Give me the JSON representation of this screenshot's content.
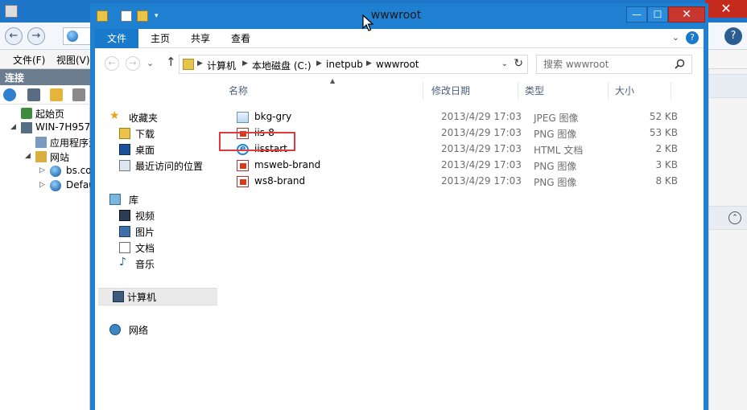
{
  "background_app": {
    "close_glyph": "✕",
    "help_glyph": "?",
    "menu": [
      {
        "label": "文件(F)"
      },
      {
        "label": "视图(V)"
      }
    ],
    "connections_label": "连接",
    "tree": [
      {
        "label": "起始页"
      },
      {
        "label": "WIN-7H957"
      },
      {
        "label": "应用程序池"
      },
      {
        "label": "网站"
      },
      {
        "label": "bs.co"
      },
      {
        "label": "Defau"
      }
    ]
  },
  "explorer": {
    "title": "wwwroot",
    "window_buttons": {
      "minimize": "—",
      "maximize": "☐",
      "close": "✕"
    },
    "ribbon": {
      "file_tab": "文件",
      "tabs": [
        "主页",
        "共享",
        "查看"
      ],
      "expand_glyph": "⌄",
      "help_glyph": "?"
    },
    "nav": {
      "back_glyph": "←",
      "forward_glyph": "→",
      "up_glyph": "↑",
      "breadcrumbs": [
        "计算机",
        "本地磁盘 (C:)",
        "inetpub",
        "wwwroot"
      ],
      "dropdown_glyph": "⌄",
      "refresh_glyph": "↻"
    },
    "search": {
      "placeholder": "搜索 wwwroot"
    },
    "nav_pane": {
      "favorites": "收藏夹",
      "favorite_items": [
        "下载",
        "桌面",
        "最近访问的位置"
      ],
      "libraries": "库",
      "library_items": [
        "视频",
        "图片",
        "文档",
        "音乐"
      ],
      "computer": "计算机",
      "network": "网络"
    },
    "columns": {
      "name": "名称",
      "date": "修改日期",
      "type": "类型",
      "size": "大小"
    },
    "files": [
      {
        "name": "bkg-gry",
        "date": "2013/4/29 17:03",
        "type": "JPEG 图像",
        "size": "52 KB",
        "icon": "jpeg-image-icon"
      },
      {
        "name": "iis-8",
        "date": "2013/4/29 17:03",
        "type": "PNG 图像",
        "size": "53 KB",
        "icon": "png-image-icon"
      },
      {
        "name": "iisstart",
        "date": "2013/4/29 17:03",
        "type": "HTML 文档",
        "size": "2 KB",
        "icon": "ie-html-icon",
        "highlighted": true
      },
      {
        "name": "msweb-brand",
        "date": "2013/4/29 17:03",
        "type": "PNG 图像",
        "size": "3 KB",
        "icon": "png-image-icon"
      },
      {
        "name": "ws8-brand",
        "date": "2013/4/29 17:03",
        "type": "PNG 图像",
        "size": "8 KB",
        "icon": "png-image-icon"
      }
    ]
  },
  "colors": {
    "title_accent": "#1f7fd0",
    "file_tab": "#1979ca",
    "highlight_border": "#e23a3a",
    "close_red": "#c7372f"
  }
}
